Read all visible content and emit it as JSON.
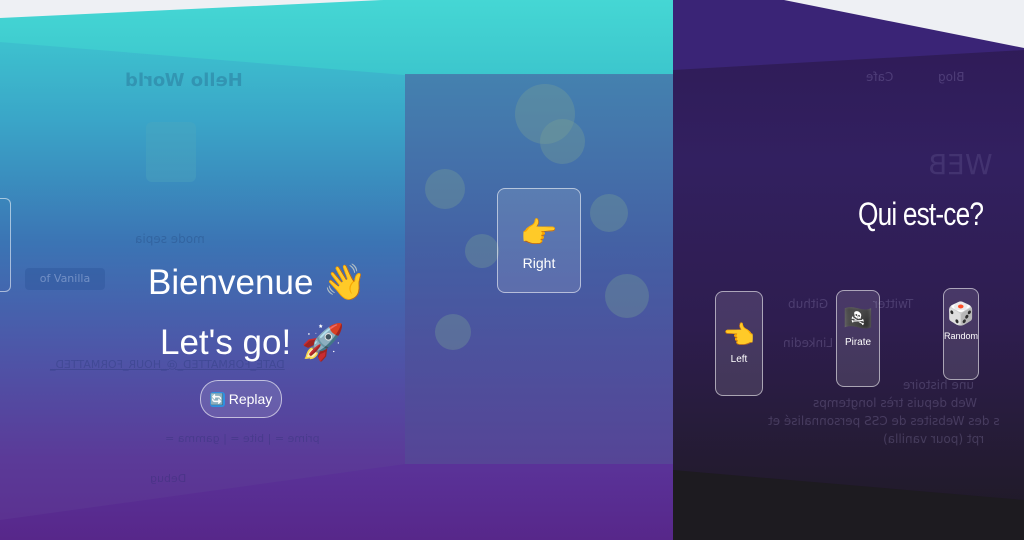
{
  "center": {
    "right_card": {
      "emoji": "👉",
      "label": "Right"
    }
  },
  "left_wall": {
    "greeting_1": "Bienvenue 👋",
    "greeting_2": "Let's go! 🚀",
    "replay": {
      "icon": "🔄",
      "label": "Replay"
    },
    "ghost_text": {
      "title": "Hello World",
      "mode": "mode sepia",
      "vanilla": "of Vanilla",
      "formatted": "DATE_FORMATTED_@_HOUR_FORMATTED_",
      "pipes": "prime = | bite = | gamma =",
      "debug": "Debug"
    }
  },
  "right_wall": {
    "title": "Qui est-ce?",
    "cards": [
      {
        "emoji": "👈",
        "label": "Left"
      },
      {
        "emoji": "🏴‍☠️",
        "label": "Pirate"
      },
      {
        "emoji": "🎲",
        "label": "Random"
      }
    ],
    "ghost_text": {
      "blog": "Blog",
      "cafe": "Cafe",
      "web": "WEB",
      "twitter": "Twitter",
      "github": "Github",
      "linkedin": "Linkedin",
      "para1": "une histoire",
      "para2": "Web depuis très longtemps",
      "para3": "s des Websites de CSS personnalisé et",
      "para4": "rpt (pour vanilla)"
    }
  },
  "colors": {
    "left_top": "#3fd0d2",
    "left_bottom": "#5b2f8e",
    "right_wall": "#2e1a55"
  }
}
